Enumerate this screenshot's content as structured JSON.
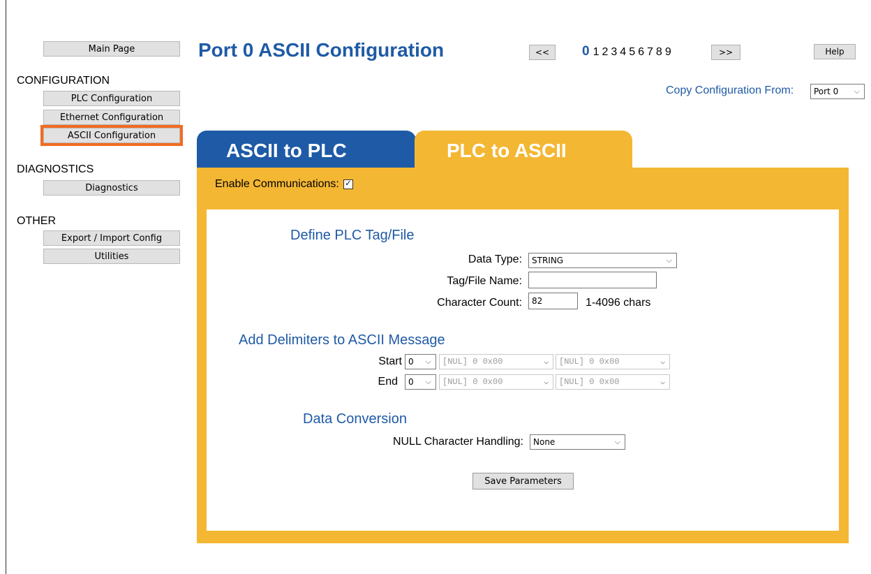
{
  "sidebar": {
    "main_page": "Main Page",
    "sections": {
      "configuration": "CONFIGURATION",
      "diagnostics": "DIAGNOSTICS",
      "other": "OTHER"
    },
    "items": {
      "plc_config": "PLC Configuration",
      "ethernet_config": "Ethernet Configuration",
      "ascii_config": "ASCII Configuration",
      "diagnostics": "Diagnostics",
      "export_import": "Export / Import Config",
      "utilities": "Utilities"
    },
    "active_item": "ASCII Configuration",
    "active_highlight_color": "#f26b21"
  },
  "header": {
    "title": "Port 0 ASCII Configuration",
    "prev_label": "<<",
    "next_label": ">>",
    "help_label": "Help",
    "current_port": "0",
    "ports": [
      "1",
      "2",
      "3",
      "4",
      "5",
      "6",
      "7",
      "8",
      "9"
    ],
    "copy_label": "Copy Configuration From:",
    "copy_value": "Port 0"
  },
  "tabs": {
    "ascii_to_plc": "ASCII to PLC",
    "plc_to_ascii": "PLC to ASCII",
    "active": "PLC to ASCII",
    "colors": {
      "blue": "#1e5aa6",
      "orange": "#f4b733"
    }
  },
  "form": {
    "enable_label": "Enable Communications:",
    "enable_checked": true,
    "define_title": "Define PLC Tag/File",
    "data_type_label": "Data Type:",
    "data_type_value": "STRING",
    "tag_name_label": "Tag/File Name:",
    "tag_name_value": "",
    "char_count_label": "Character Count:",
    "char_count_value": "82",
    "char_count_hint": "1-4096 chars",
    "delimiters_title": "Add Delimiters to ASCII Message",
    "start_label": "Start",
    "start_count": "0",
    "start_delim1": "[NUL]  0 0x00",
    "start_delim2": "[NUL]  0 0x00",
    "end_label": "End",
    "end_count": "0",
    "end_delim1": "[NUL]  0 0x00",
    "end_delim2": "[NUL]  0 0x00",
    "conversion_title": "Data Conversion",
    "null_label": "NULL Character Handling:",
    "null_value": "None",
    "save_label": "Save Parameters"
  }
}
